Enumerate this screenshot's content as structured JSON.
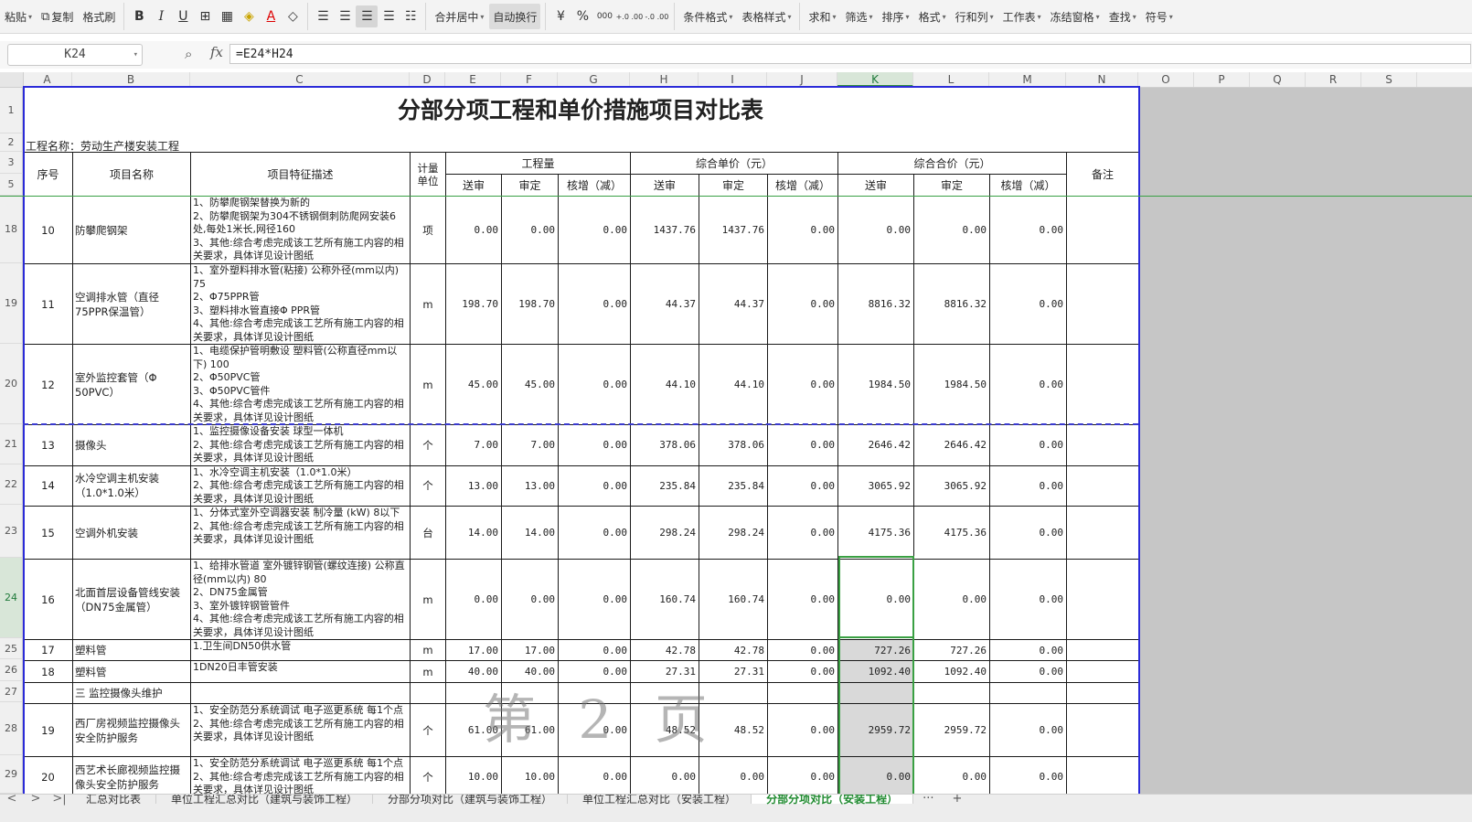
{
  "ribbon": {
    "paste": "粘贴",
    "copy": "复制",
    "format_painter": "格式刷",
    "merge_center": "合并居中",
    "wrap_text": "自动换行",
    "percent": "%",
    "thousands": "000",
    "inc_decimal": "+.0 .00",
    "dec_decimal": "-.0 .00",
    "conditional_format": "条件格式",
    "table_style": "表格样式",
    "sum": "求和",
    "filter": "筛选",
    "sort": "排序",
    "format": "格式",
    "row_col": "行和列",
    "worksheet": "工作表",
    "freeze": "冻结窗格",
    "find": "查找",
    "symbol": "符号"
  },
  "formula_bar": {
    "name_box": "K24",
    "fx": "fx",
    "formula": "=E24*H24"
  },
  "columns": [
    "A",
    "B",
    "C",
    "D",
    "E",
    "F",
    "G",
    "H",
    "I",
    "J",
    "K",
    "L",
    "M",
    "N",
    "O",
    "P",
    "Q",
    "R",
    "S"
  ],
  "row_headers": [
    "1",
    "2",
    "3",
    "5",
    "18",
    "19",
    "20",
    "21",
    "22",
    "23",
    "24",
    "25",
    "26",
    "27",
    "28",
    "29"
  ],
  "sheet": {
    "title": "分部分项工程和单价措施项目对比表",
    "project_name": "工程名称：劳动生产楼安装工程",
    "headers": {
      "seq": "序号",
      "item_name": "项目名称",
      "item_desc": "项目特征描述",
      "unit": "计量单位",
      "quantity": "工程量",
      "unit_price": "综合单价（元）",
      "total": "综合合价（元）",
      "remark": "备注",
      "submitted": "送审",
      "approved": "审定",
      "adjust": "核增（减）"
    },
    "rows": [
      {
        "seq": "10",
        "name": "防攀爬钢架",
        "desc": "1、防攀爬钢架替换为新的\n2、防攀爬钢架为304不锈钢倒刺防爬网安装6处,每处1米长,网径160\n3、其他:综合考虑完成该工艺所有施工内容的相关要求，具体详见设计图纸",
        "unit": "项",
        "q1": "0.00",
        "q2": "0.00",
        "q3": "0.00",
        "p1": "1437.76",
        "p2": "1437.76",
        "p3": "0.00",
        "t1": "0.00",
        "t2": "0.00",
        "t3": "0.00"
      },
      {
        "seq": "11",
        "name": "空调排水管（直径75PPR保温管）",
        "desc": "1、室外塑料排水管(粘接) 公称外径(mm以内) 75\n2、Φ75PPR管\n3、塑料排水管直接Φ PPR管\n4、其他:综合考虑完成该工艺所有施工内容的相关要求，具体详见设计图纸",
        "unit": "m",
        "q1": "198.70",
        "q2": "198.70",
        "q3": "0.00",
        "p1": "44.37",
        "p2": "44.37",
        "p3": "0.00",
        "t1": "8816.32",
        "t2": "8816.32",
        "t3": "0.00"
      },
      {
        "seq": "12",
        "name": "室外监控套管（Φ 50PVC）",
        "desc": "1、电缆保护管明敷设 塑料管(公称直径mm以下) 100\n2、Φ50PVC管\n3、Φ50PVC管件\n4、其他:综合考虑完成该工艺所有施工内容的相关要求，具体详见设计图纸",
        "unit": "m",
        "q1": "45.00",
        "q2": "45.00",
        "q3": "0.00",
        "p1": "44.10",
        "p2": "44.10",
        "p3": "0.00",
        "t1": "1984.50",
        "t2": "1984.50",
        "t3": "0.00"
      },
      {
        "seq": "13",
        "name": "摄像头",
        "desc": "1、监控摄像设备安装 球型一体机\n2、其他:综合考虑完成该工艺所有施工内容的相关要求，具体详见设计图纸",
        "unit": "个",
        "q1": "7.00",
        "q2": "7.00",
        "q3": "0.00",
        "p1": "378.06",
        "p2": "378.06",
        "p3": "0.00",
        "t1": "2646.42",
        "t2": "2646.42",
        "t3": "0.00"
      },
      {
        "seq": "14",
        "name": "水冷空调主机安装（1.0*1.0米）",
        "desc": "1、水冷空调主机安装（1.0*1.0米）\n2、其他:综合考虑完成该工艺所有施工内容的相关要求，具体详见设计图纸",
        "unit": "个",
        "q1": "13.00",
        "q2": "13.00",
        "q3": "0.00",
        "p1": "235.84",
        "p2": "235.84",
        "p3": "0.00",
        "t1": "3065.92",
        "t2": "3065.92",
        "t3": "0.00"
      },
      {
        "seq": "15",
        "name": "空调外机安装",
        "desc": "1、分体式室外空调器安装 制冷量 (kW) 8以下\n2、其他:综合考虑完成该工艺所有施工内容的相关要求，具体详见设计图纸",
        "unit": "台",
        "q1": "14.00",
        "q2": "14.00",
        "q3": "0.00",
        "p1": "298.24",
        "p2": "298.24",
        "p3": "0.00",
        "t1": "4175.36",
        "t2": "4175.36",
        "t3": "0.00"
      },
      {
        "seq": "16",
        "name": "北面首层设备管线安装（DN75金属管）",
        "desc": "1、给排水管道 室外镀锌钢管(螺纹连接) 公称直径(mm以内) 80\n2、DN75金属管\n3、室外镀锌钢管管件\n4、其他:综合考虑完成该工艺所有施工内容的相关要求，具体详见设计图纸",
        "unit": "m",
        "q1": "0.00",
        "q2": "0.00",
        "q3": "0.00",
        "p1": "160.74",
        "p2": "160.74",
        "p3": "0.00",
        "t1": "0.00",
        "t2": "0.00",
        "t3": "0.00"
      },
      {
        "seq": "17",
        "name": "塑料管",
        "desc": "1.卫生间DN50供水管",
        "unit": "m",
        "q1": "17.00",
        "q2": "17.00",
        "q3": "0.00",
        "p1": "42.78",
        "p2": "42.78",
        "p3": "0.00",
        "t1": "727.26",
        "t2": "727.26",
        "t3": "0.00"
      },
      {
        "seq": "18",
        "name": "塑料管",
        "desc": "1DN20日丰管安装",
        "unit": "m",
        "q1": "40.00",
        "q2": "40.00",
        "q3": "0.00",
        "p1": "27.31",
        "p2": "27.31",
        "p3": "0.00",
        "t1": "1092.40",
        "t2": "1092.40",
        "t3": "0.00"
      },
      {
        "seq": "",
        "name": "三 监控摄像头维护",
        "desc": "",
        "unit": "",
        "q1": "",
        "q2": "",
        "q3": "",
        "p1": "",
        "p2": "",
        "p3": "",
        "t1": "",
        "t2": "",
        "t3": ""
      },
      {
        "seq": "19",
        "name": "西厂房视频监控摄像头安全防护服务",
        "desc": "1、安全防范分系统调试 电子巡更系统 每1个点\n2、其他:综合考虑完成该工艺所有施工内容的相关要求，具体详见设计图纸",
        "unit": "个",
        "q1": "61.00",
        "q2": "61.00",
        "q3": "0.00",
        "p1": "48.52",
        "p2": "48.52",
        "p3": "0.00",
        "t1": "2959.72",
        "t2": "2959.72",
        "t3": "0.00"
      },
      {
        "seq": "20",
        "name": "西艺术长廊视频监控摄像头安全防护服务",
        "desc": "1、安全防范分系统调试 电子巡更系统 每1个点\n2、其他:综合考虑完成该工艺所有施工内容的相关要求，具体详见设计图纸",
        "unit": "个",
        "q1": "10.00",
        "q2": "10.00",
        "q3": "0.00",
        "p1": "0.00",
        "p2": "0.00",
        "p3": "0.00",
        "t1": "0.00",
        "t2": "0.00",
        "t3": "0.00"
      }
    ]
  },
  "watermark": "第 2 页",
  "tabs": {
    "nav": [
      "<",
      ">",
      ">|"
    ],
    "items": [
      "汇总对比表",
      "单位工程汇总对比（建筑与装饰工程）",
      "分部分项对比（建筑与装饰工程）",
      "单位工程汇总对比（安装工程）",
      "分部分项对比（安装工程）"
    ],
    "more": "···",
    "add": "+"
  }
}
